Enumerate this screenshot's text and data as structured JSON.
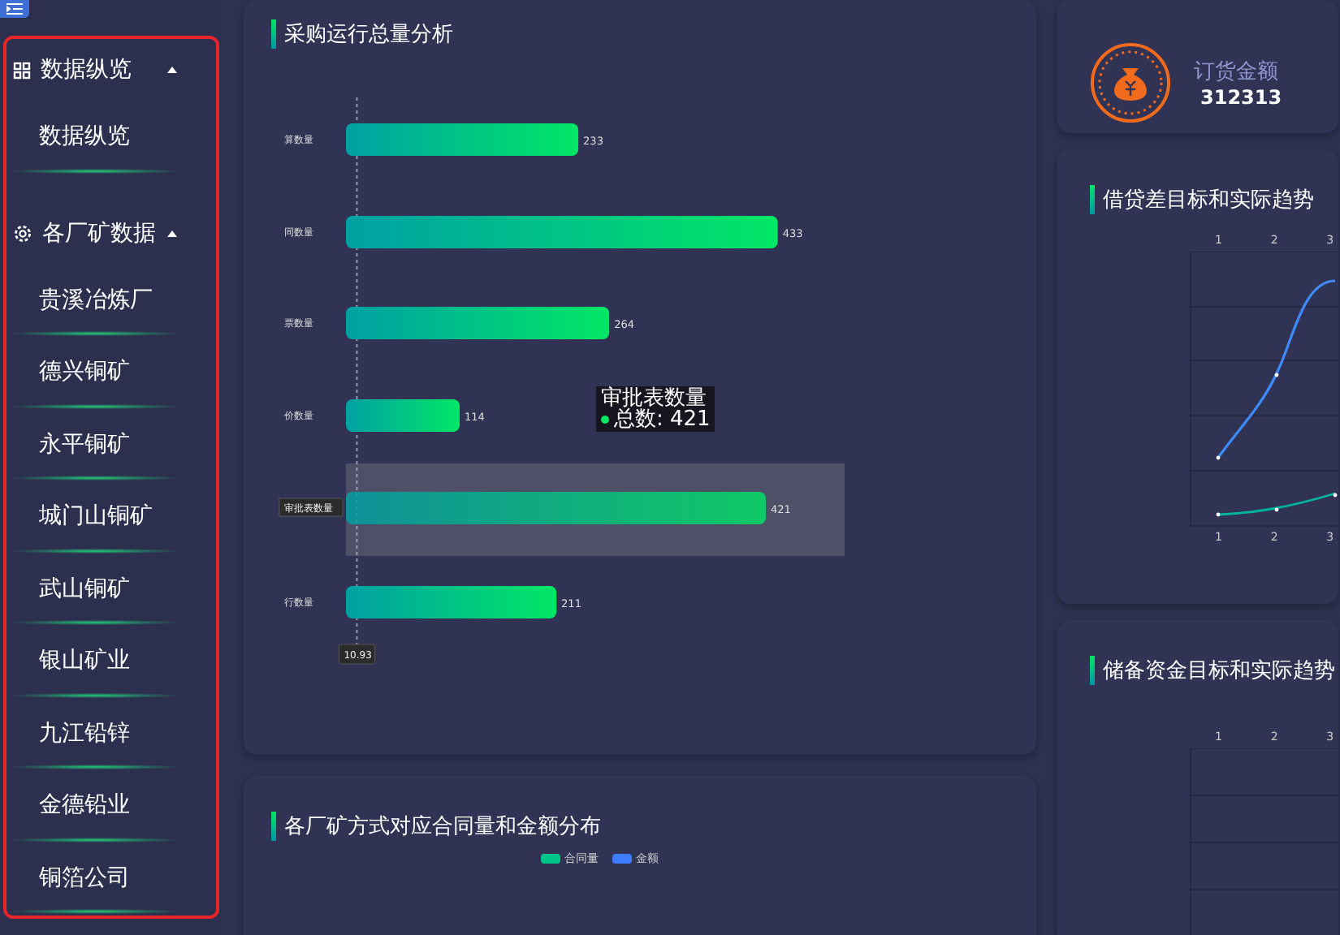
{
  "sidebar": {
    "groups": [
      {
        "title": "数据纵览",
        "expanded": true,
        "items": [
          {
            "label": "数据纵览",
            "selected": false
          }
        ]
      },
      {
        "title": "各厂矿数据",
        "expanded": true,
        "items": [
          {
            "label": "贵溪冶炼厂",
            "selected": false
          },
          {
            "label": "德兴铜矿",
            "selected": false
          },
          {
            "label": "永平铜矿",
            "selected": false
          },
          {
            "label": "城门山铜矿",
            "selected": false
          },
          {
            "label": "武山铜矿",
            "selected": false
          },
          {
            "label": "银山矿业",
            "selected": false
          },
          {
            "label": "九江铅锌",
            "selected": false
          },
          {
            "label": "金德铅业",
            "selected": false
          },
          {
            "label": "铜箔公司",
            "selected": false
          }
        ]
      }
    ]
  },
  "purchase_card": {
    "title": "采购运行总量分析",
    "chart_data": {
      "type": "bar",
      "orientation": "horizontal",
      "categories": [
        "算数量",
        "同数量",
        "票数量",
        "价数量",
        "审批表数量",
        "行数量"
      ],
      "series": [
        {
          "color": "#00e765",
          "values": [
            233,
            433,
            264,
            114,
            421,
            211
          ]
        }
      ],
      "xlim": [
        0,
        500
      ],
      "data_labels": true,
      "ref_lines": [
        {
          "axis": "x",
          "value": 10.93,
          "label": "10.93"
        }
      ],
      "bands": [
        {
          "axis": "y",
          "from": "审批表数量",
          "to": "审批表数量"
        }
      ]
    },
    "tooltip": {
      "title": "审批表数量",
      "label": "总数: 421",
      "color": "#00e765"
    }
  },
  "distribution_card": {
    "title": "各厂矿方式对应合同量和金额分布",
    "legend": [
      {
        "label": "合同量",
        "color": "#00c58a"
      },
      {
        "label": "金额",
        "color": "#3d7bff"
      }
    ]
  },
  "order_card": {
    "label": "订货金额",
    "value": "312313"
  },
  "trend_cards": [
    {
      "title": "借贷差目标和实际趋势",
      "top_ticks": [
        "1",
        "2",
        "3"
      ],
      "bottom_ticks": [
        "1",
        "2",
        "3"
      ]
    },
    {
      "title": "储备资金目标和实际趋势",
      "top_ticks": [
        "1",
        "2",
        "3"
      ]
    }
  ]
}
